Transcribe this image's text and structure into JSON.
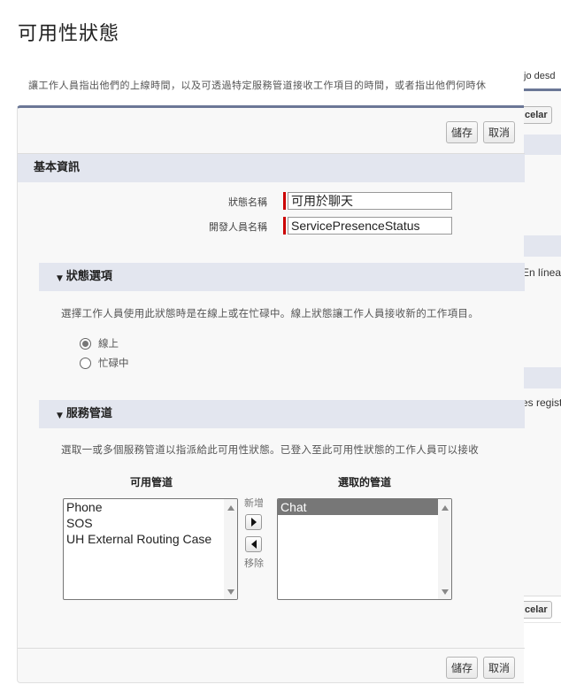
{
  "background_page": {
    "desc_fragment": "jo desd",
    "cancel_fragment": "celar",
    "online_fragment": "En línea",
    "registered_fragment": "es regist"
  },
  "page": {
    "title": "可用性狀態",
    "description": "讓工作人員指出他們的上線時間，以及可透過特定服務管道接收工作項目的時間，或者指出他們何時休"
  },
  "toolbar": {
    "save_label": "儲存",
    "cancel_label": "取消"
  },
  "basic_info": {
    "heading": "基本資訊",
    "status_name_label": "狀態名稱",
    "status_name_value": "可用於聊天",
    "developer_name_label": "開發人員名稱",
    "developer_name_value": "ServicePresenceStatus"
  },
  "status_options": {
    "heading": "狀態選項",
    "description": "選擇工作人員使用此狀態時是在線上或在忙碌中。線上狀態讓工作人員接收新的工作項目。",
    "options": [
      {
        "label": "線上",
        "selected": true
      },
      {
        "label": "忙碌中",
        "selected": false
      }
    ]
  },
  "service_channels": {
    "heading": "服務管道",
    "description": "選取一或多個服務管道以指派給此可用性狀態。已登入至此可用性狀態的工作人員可以接收",
    "available_label": "可用管道",
    "selected_label": "選取的管道",
    "available": [
      "Phone",
      "SOS",
      "UH External Routing Case"
    ],
    "selected": [
      "Chat"
    ],
    "add_label": "新增",
    "remove_label": "移除"
  }
}
